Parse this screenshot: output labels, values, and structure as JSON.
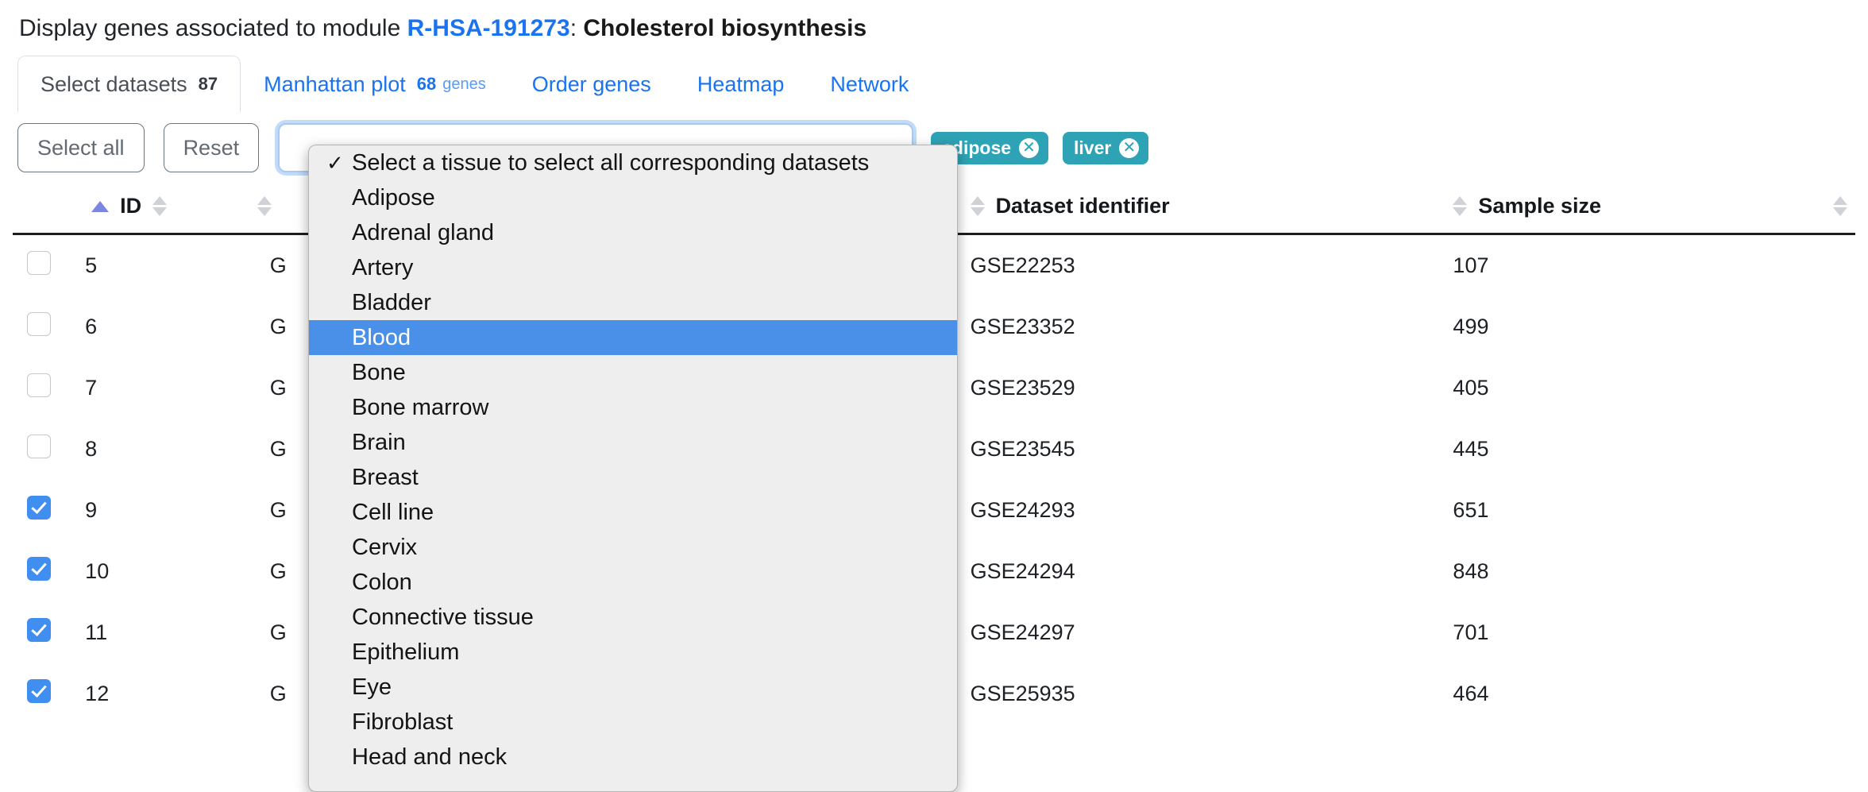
{
  "header": {
    "prefix": "Display genes associated to module ",
    "module_id": "R-HSA-191273",
    "separator": ": ",
    "module_name": "Cholesterol biosynthesis"
  },
  "tabs": [
    {
      "label": "Select datasets",
      "count": "87",
      "unit": "",
      "active": true
    },
    {
      "label": "Manhattan plot",
      "count": "68",
      "unit": "genes",
      "active": false
    },
    {
      "label": "Order genes",
      "count": "",
      "unit": "",
      "active": false
    },
    {
      "label": "Heatmap",
      "count": "",
      "unit": "",
      "active": false
    },
    {
      "label": "Network",
      "count": "",
      "unit": "",
      "active": false
    }
  ],
  "toolbar": {
    "select_all_label": "Select all",
    "reset_label": "Reset",
    "badges": [
      {
        "label": "adipose",
        "remove_icon": "✕"
      },
      {
        "label": "liver",
        "remove_icon": "✕"
      }
    ],
    "badge_color": "#2ea3b5"
  },
  "dropdown": {
    "open": true,
    "selected": "Select a tissue to select all corresponding datasets",
    "highlighted": "Blood",
    "check_glyph": "✓",
    "options": [
      "Select a tissue to select all corresponding datasets",
      "Adipose",
      "Adrenal gland",
      "Artery",
      "Bladder",
      "Blood",
      "Bone",
      "Bone marrow",
      "Brain",
      "Breast",
      "Cell line",
      "Cervix",
      "Colon",
      "Connective tissue",
      "Epithelium",
      "Eye",
      "Fibroblast",
      "Head and neck"
    ]
  },
  "table": {
    "columns": [
      {
        "key": "check",
        "label": ""
      },
      {
        "key": "id",
        "label": "ID"
      },
      {
        "key": "hidden",
        "label": ""
      },
      {
        "key": "dataset_identifier",
        "label": "Dataset identifier"
      },
      {
        "key": "sample_size",
        "label": "Sample size"
      }
    ],
    "sort": {
      "column": "ID",
      "direction": "asc"
    },
    "rows": [
      {
        "checked": false,
        "id": "5",
        "hidden": "G",
        "dataset_identifier": "GSE22253",
        "sample_size": "107"
      },
      {
        "checked": false,
        "id": "6",
        "hidden": "G",
        "dataset_identifier": "GSE23352",
        "sample_size": "499"
      },
      {
        "checked": false,
        "id": "7",
        "hidden": "G",
        "dataset_identifier": "GSE23529",
        "sample_size": "405"
      },
      {
        "checked": false,
        "id": "8",
        "hidden": "G",
        "dataset_identifier": "GSE23545",
        "sample_size": "445"
      },
      {
        "checked": true,
        "id": "9",
        "hidden": "G",
        "dataset_identifier": "GSE24293",
        "sample_size": "651"
      },
      {
        "checked": true,
        "id": "10",
        "hidden": "G",
        "dataset_identifier": "GSE24294",
        "sample_size": "848"
      },
      {
        "checked": true,
        "id": "11",
        "hidden": "G",
        "dataset_identifier": "GSE24297",
        "sample_size": "701"
      },
      {
        "checked": true,
        "id": "12",
        "hidden": "G",
        "dataset_identifier": "GSE25935",
        "sample_size": "464"
      }
    ]
  }
}
